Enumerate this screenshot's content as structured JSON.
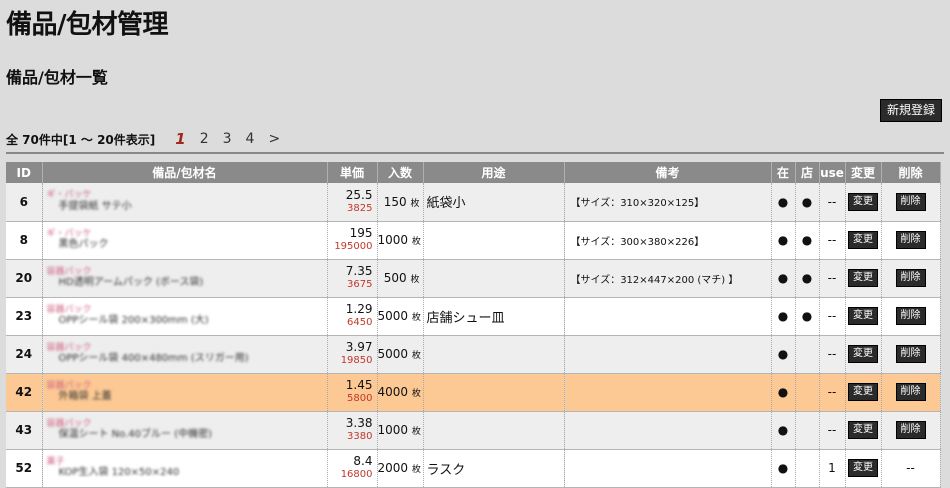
{
  "page_title": "備品/包材管理",
  "section_title": "備品/包材一覧",
  "new_button": "新規登録",
  "summary": "全 70件中[1 ～ 20件表示]",
  "pager": {
    "current": "1",
    "pages": [
      "2",
      "3",
      "4"
    ],
    "next": ">"
  },
  "headers": {
    "id": "ID",
    "name": "備品/包材名",
    "price": "単価",
    "qty": "入数",
    "use": "用途",
    "note": "備考",
    "zai": "在",
    "ten": "店",
    "usecol": "use",
    "edit": "変更",
    "del": "削除"
  },
  "edit_label": "変更",
  "delete_label": "削除",
  "rows": [
    {
      "id": "6",
      "cat": "ギ・パッケ",
      "name": "手提袋紙 サテ小",
      "price": "25.5",
      "total": "3825",
      "qty": "150",
      "unit": "枚",
      "use": "紙袋小",
      "note": "【サイズ：310×320×125】",
      "zai": "●",
      "ten": "●",
      "usecol": "--",
      "edit": "変更",
      "del": "削除"
    },
    {
      "id": "8",
      "cat": "ギ・パッケ",
      "name": "黒色パック",
      "price": "195",
      "total": "195000",
      "qty": "1000",
      "unit": "枚",
      "use": "",
      "note": "【サイズ：300×380×226】",
      "zai": "●",
      "ten": "●",
      "usecol": "--",
      "edit": "変更",
      "del": "削除"
    },
    {
      "id": "20",
      "cat": "容器パック",
      "name": "HD透明アームパック (ボース袋)",
      "price": "7.35",
      "total": "3675",
      "qty": "500",
      "unit": "枚",
      "use": "",
      "note": "【サイズ：312×447×200 (マチ) 】",
      "zai": "●",
      "ten": "●",
      "usecol": "--",
      "edit": "変更",
      "del": "削除"
    },
    {
      "id": "23",
      "cat": "容器パック",
      "name": "OPPシール袋 200×300mm (大)",
      "price": "1.29",
      "total": "6450",
      "qty": "5000",
      "unit": "枚",
      "use": "店舗シュー皿",
      "note": "",
      "zai": "●",
      "ten": "●",
      "usecol": "--",
      "edit": "変更",
      "del": "削除"
    },
    {
      "id": "24",
      "cat": "容器パック",
      "name": "OPPシール袋 400×480mm (スリガー用)",
      "price": "3.97",
      "total": "19850",
      "qty": "5000",
      "unit": "枚",
      "use": "",
      "note": "",
      "zai": "●",
      "ten": "",
      "usecol": "--",
      "edit": "変更",
      "del": "削除"
    },
    {
      "id": "42",
      "cat": "容器パック",
      "name": "外箱袋 上蓋",
      "price": "1.45",
      "total": "5800",
      "qty": "4000",
      "unit": "枚",
      "use": "",
      "note": "",
      "zai": "●",
      "ten": "",
      "usecol": "--",
      "edit": "変更",
      "del": "削除",
      "hl": true
    },
    {
      "id": "43",
      "cat": "容器パック",
      "name": "保温シート No.40ブルー (中機密)",
      "price": "3.38",
      "total": "3380",
      "qty": "1000",
      "unit": "枚",
      "use": "",
      "note": "",
      "zai": "●",
      "ten": "",
      "usecol": "--",
      "edit": "変更",
      "del": "削除"
    },
    {
      "id": "52",
      "cat": "菓子",
      "name": "KOP生入袋 120×50×240",
      "price": "8.4",
      "total": "16800",
      "qty": "2000",
      "unit": "枚",
      "use": "ラスク",
      "note": "",
      "zai": "●",
      "ten": "",
      "usecol": "1",
      "edit": "変更",
      "del": "--",
      "del_disabled": true
    }
  ]
}
